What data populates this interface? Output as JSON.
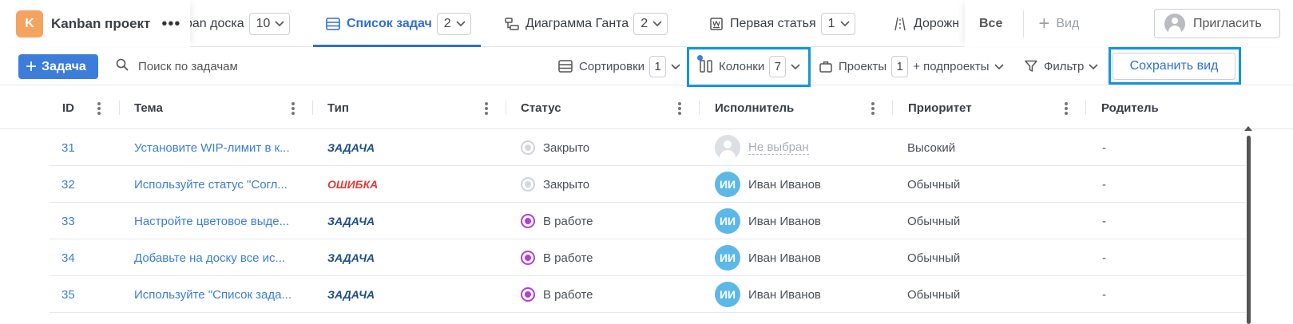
{
  "project": {
    "logo_letter": "K",
    "name": "Kanban проект",
    "more": "•••"
  },
  "tabs": [
    {
      "label": "ban доска",
      "count": "10"
    },
    {
      "label": "Список задач",
      "count": "2",
      "active": true
    },
    {
      "label": "Диаграмма Ганта",
      "count": "2"
    },
    {
      "label": "Первая статья",
      "count": "1"
    },
    {
      "label": "Дорожн",
      "count": ""
    }
  ],
  "topright": {
    "all": "Все",
    "add_view": "Вид",
    "invite": "Пригласить"
  },
  "toolbar": {
    "new_task": "Задача",
    "search_placeholder": "Поиск по задачам",
    "sort_label": "Сортировки",
    "sort_count": "1",
    "columns_label": "Колонки",
    "columns_count": "7",
    "projects_label": "Проекты",
    "projects_count": "1",
    "subprojects_label": "+ подпроекты",
    "filter_label": "Фильтр",
    "save_view": "Сохранить вид"
  },
  "table": {
    "headers": [
      "ID",
      "Тема",
      "Тип",
      "Статус",
      "Исполнитель",
      "Приоритет",
      "Родитель"
    ],
    "rows": [
      {
        "id": "31",
        "subject": "Установите WIP-лимит в к...",
        "type": "ЗАДАЧА",
        "type_kind": "task",
        "status": "Закрыто",
        "status_kind": "closed",
        "assignee": "Не выбран",
        "assignee_initials": "",
        "priority": "Высокий",
        "parent": "-"
      },
      {
        "id": "32",
        "subject": "Используйте статус \"Согл...",
        "type": "ОШИБКА",
        "type_kind": "bug",
        "status": "Закрыто",
        "status_kind": "closed",
        "assignee": "Иван Иванов",
        "assignee_initials": "ИИ",
        "priority": "Обычный",
        "parent": "-"
      },
      {
        "id": "33",
        "subject": "Настройте цветовое выде...",
        "type": "ЗАДАЧА",
        "type_kind": "task",
        "status": "В работе",
        "status_kind": "work",
        "assignee": "Иван Иванов",
        "assignee_initials": "ИИ",
        "priority": "Обычный",
        "parent": "-"
      },
      {
        "id": "34",
        "subject": "Добавьте на доску все ис...",
        "type": "ЗАДАЧА",
        "type_kind": "task",
        "status": "В работе",
        "status_kind": "work",
        "assignee": "Иван Иванов",
        "assignee_initials": "ИИ",
        "priority": "Обычный",
        "parent": "-"
      },
      {
        "id": "35",
        "subject": "Используйте \"Список зада...",
        "type": "ЗАДАЧА",
        "type_kind": "task",
        "status": "В работе",
        "status_kind": "work",
        "assignee": "Иван Иванов",
        "assignee_initials": "ИИ",
        "priority": "Обычный",
        "parent": "-"
      }
    ]
  },
  "colors": {
    "accent": "#2f6fd6",
    "primary_button": "#3b7dd8",
    "highlight": "#1296db",
    "bug": "#e23b3b",
    "in_progress": "#b13fd8",
    "avatar": "#5bb8e8",
    "logo": "#f4a460"
  }
}
